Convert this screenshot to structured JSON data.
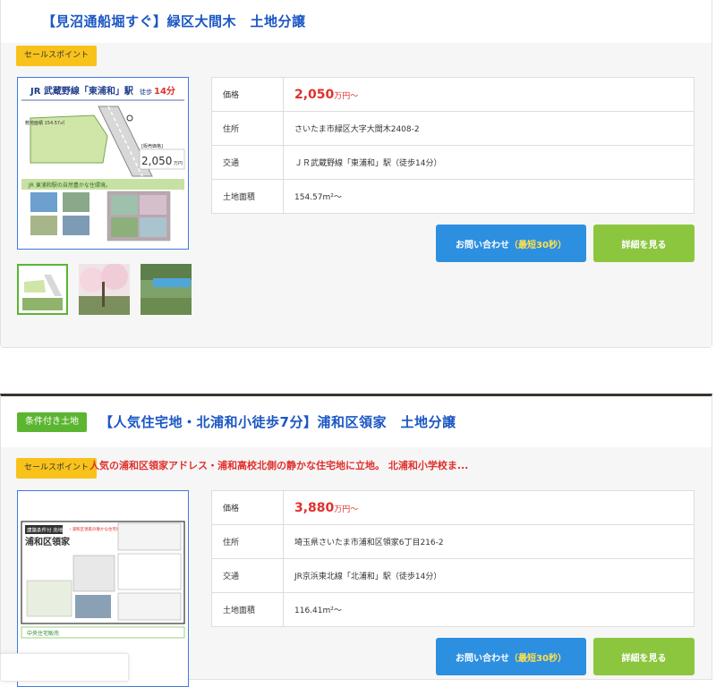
{
  "listings": [
    {
      "title": "【見沼通船堀すぐ】緑区大間木　土地分譲",
      "sale_tag": "セールスポイント",
      "main_image": {
        "line": "JR 武蔵野線「東浦和」駅",
        "walk_label": "徒歩",
        "walk_min": "14分",
        "area_text": "敷地面積 154.57㎡",
        "price_label": "[販売価格]",
        "price": "2,050",
        "price_unit": "万円",
        "caption": "JR 東浦和駅の自然豊かな住環境。"
      },
      "info": {
        "price_label": "価格",
        "price_value": "2,050",
        "price_unit": "万円〜",
        "address_label": "住所",
        "address": "さいたま市緑区大字大間木2408-2",
        "traffic_label": "交通",
        "traffic": "ＪＲ武蔵野線「東浦和」駅（徒歩14分）",
        "area_label": "土地面積",
        "area": "154.57m²〜"
      },
      "buttons": {
        "contact": "お問い合わせ",
        "contact_note": "（最短30秒）",
        "detail": "詳細を見る"
      }
    },
    {
      "condition_tag": "条件付き土地",
      "title": "【人気住宅地・北浦和小徒歩7分】浦和区領家　土地分譲",
      "sale_tag": "セールスポイント",
      "sale_text": "人気の浦和区領家アドレス・浦和高校北側の静かな住宅地に立地。 北浦和小学校ま...",
      "main_image": {
        "badge": "建築条件付 売地",
        "area_name": "浦和区領家",
        "bullets": "・浦和区領家の静かな住宅地。",
        "company": "中央住宅販売"
      },
      "info": {
        "price_label": "価格",
        "price_value": "3,880",
        "price_unit": "万円〜",
        "address_label": "住所",
        "address": "埼玉県さいたま市浦和区領家6丁目216-2",
        "traffic_label": "交通",
        "traffic": "JR京浜東北線「北浦和」駅（徒歩14分）",
        "area_label": "土地面積",
        "area": "116.41m²〜"
      },
      "buttons": {
        "contact": "お問い合わせ",
        "contact_note": "（最短30秒）",
        "detail": "詳細を見る"
      }
    }
  ],
  "colors": {
    "title": "#1a56c4",
    "price": "#e0302c",
    "contact_button": "#2d8fe0",
    "detail_button": "#8cc63f",
    "sale_tag": "#f8c21a",
    "condition_tag": "#5cb531"
  }
}
